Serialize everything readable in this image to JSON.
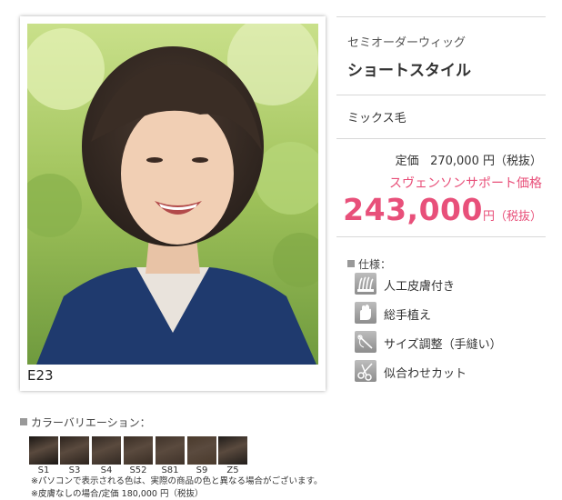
{
  "photo": {
    "product_code": "E23"
  },
  "product": {
    "subtitle": "セミオーダーウィッグ",
    "title": "ショートスタイル",
    "hair_type": "ミックス毛",
    "list_price_label": "定価",
    "list_price": "270,000 円（税抜）",
    "support_price_label": "スヴェンソンサポート価格",
    "support_price": "243,000",
    "support_price_unit": "円（税抜）"
  },
  "spec": {
    "heading": "仕様：",
    "items": [
      {
        "label": "人工皮膚付き",
        "icon": "artificial-skin-icon"
      },
      {
        "label": "総手植え",
        "icon": "hand-tied-icon"
      },
      {
        "label": "サイズ調整（手縫い）",
        "icon": "sewing-needle-icon"
      },
      {
        "label": "似合わせカット",
        "icon": "scissors-icon"
      }
    ]
  },
  "colors": {
    "heading": "カラーバリエーション：",
    "swatches": [
      {
        "code": "S1",
        "color": "#1b1714"
      },
      {
        "code": "S3",
        "color": "#2c231d"
      },
      {
        "code": "S4",
        "color": "#332a24"
      },
      {
        "code": "S52",
        "color": "#3a2e25"
      },
      {
        "code": "S81",
        "color": "#40332a"
      },
      {
        "code": "S9",
        "color": "#4a3a2c"
      },
      {
        "code": "Z5",
        "color": "#211d1a"
      }
    ],
    "notes": [
      "※パソコンで表示される色は、実際の商品の色と異なる場合がございます。",
      "※皮膚なしの場合/定価 180,000 円（税抜）"
    ]
  },
  "theme": {
    "accent_pink": "#e8507a",
    "rule_gray": "#d8d8d8"
  }
}
